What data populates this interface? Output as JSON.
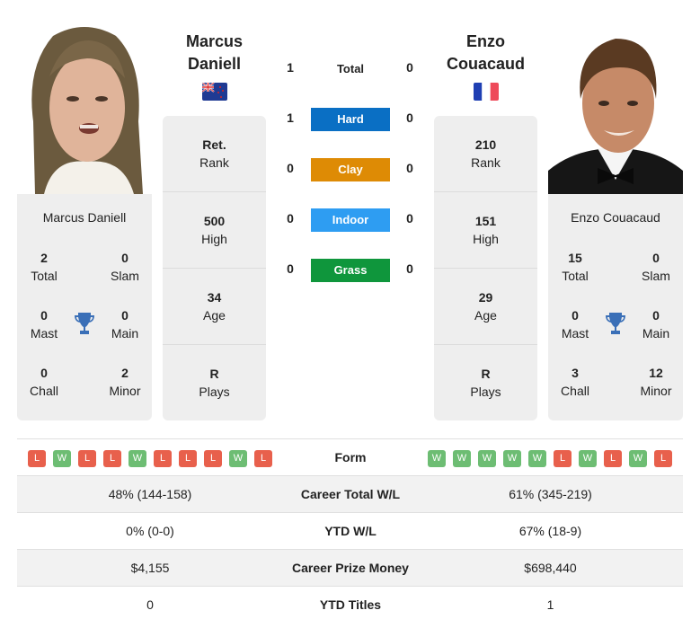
{
  "colors": {
    "hard": "#0a6fc4",
    "clay": "#de8b05",
    "indoor": "#2e9df2",
    "grass": "#0f963c",
    "win": "#6dbd73",
    "loss": "#e8604c",
    "trophy": "#3a6fb7"
  },
  "player1": {
    "first_name": "Marcus",
    "last_name": "Daniell",
    "full_name": "Marcus Daniell",
    "flag": "new-zealand-flag",
    "titles": {
      "total": "2",
      "total_label": "Total",
      "slam": "0",
      "slam_label": "Slam",
      "mast": "0",
      "mast_label": "Mast",
      "main": "0",
      "main_label": "Main",
      "chall": "0",
      "chall_label": "Chall",
      "minor": "2",
      "minor_label": "Minor"
    },
    "stats": {
      "rank": "Ret.",
      "rank_label": "Rank",
      "high": "500",
      "high_label": "High",
      "age": "34",
      "age_label": "Age",
      "plays": "R",
      "plays_label": "Plays"
    },
    "form": [
      "L",
      "W",
      "L",
      "L",
      "W",
      "L",
      "L",
      "L",
      "W",
      "L"
    ],
    "career_wl": "48% (144-158)",
    "ytd_wl": "0% (0-0)",
    "prize_money": "$4,155",
    "ytd_titles": "0"
  },
  "player2": {
    "first_name": "Enzo",
    "last_name": "Couacaud",
    "full_name": "Enzo Couacaud",
    "flag": "france-flag",
    "titles": {
      "total": "15",
      "total_label": "Total",
      "slam": "0",
      "slam_label": "Slam",
      "mast": "0",
      "mast_label": "Mast",
      "main": "0",
      "main_label": "Main",
      "chall": "3",
      "chall_label": "Chall",
      "minor": "12",
      "minor_label": "Minor"
    },
    "stats": {
      "rank": "210",
      "rank_label": "Rank",
      "high": "151",
      "high_label": "High",
      "age": "29",
      "age_label": "Age",
      "plays": "R",
      "plays_label": "Plays"
    },
    "form": [
      "W",
      "W",
      "W",
      "W",
      "W",
      "L",
      "W",
      "L",
      "W",
      "L"
    ],
    "career_wl": "61% (345-219)",
    "ytd_wl": "67% (18-9)",
    "prize_money": "$698,440",
    "ytd_titles": "1"
  },
  "h2h": {
    "total": {
      "label": "Total",
      "p1": "1",
      "p2": "0"
    },
    "hard": {
      "label": "Hard",
      "p1": "1",
      "p2": "0"
    },
    "clay": {
      "label": "Clay",
      "p1": "0",
      "p2": "0"
    },
    "indoor": {
      "label": "Indoor",
      "p1": "0",
      "p2": "0"
    },
    "grass": {
      "label": "Grass",
      "p1": "0",
      "p2": "0"
    }
  },
  "rows": {
    "form": "Form",
    "career_wl": "Career Total W/L",
    "ytd_wl": "YTD W/L",
    "prize_money": "Career Prize Money",
    "ytd_titles": "YTD Titles"
  }
}
